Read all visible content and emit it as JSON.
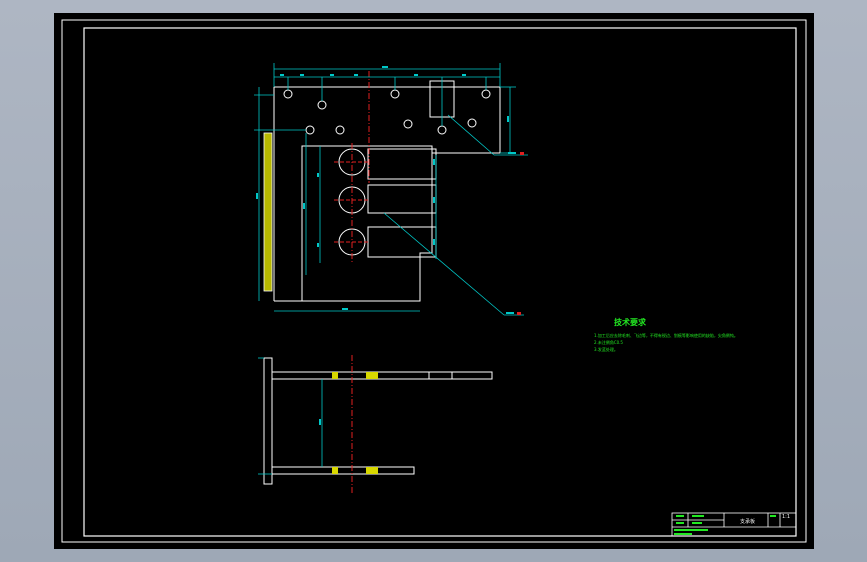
{
  "drawing": {
    "technical_requirements": {
      "title": "技术要求",
      "items": [
        "1.加工后应去除毛刺、飞边等，不得有锐边、划痕等影响使用的缺陷，尖角倒钝。",
        "2.未注倒角C0.5",
        "3.发蓝处理。"
      ]
    },
    "title_block": {
      "part_name": "支承板",
      "scale": "1:1"
    },
    "colors": {
      "sheet_background": "#000000",
      "outline": "#ffffff",
      "dimension": "#00c8c8",
      "centerline": "#e02020",
      "hatch": "#d8d800",
      "text": "#22e822"
    }
  }
}
